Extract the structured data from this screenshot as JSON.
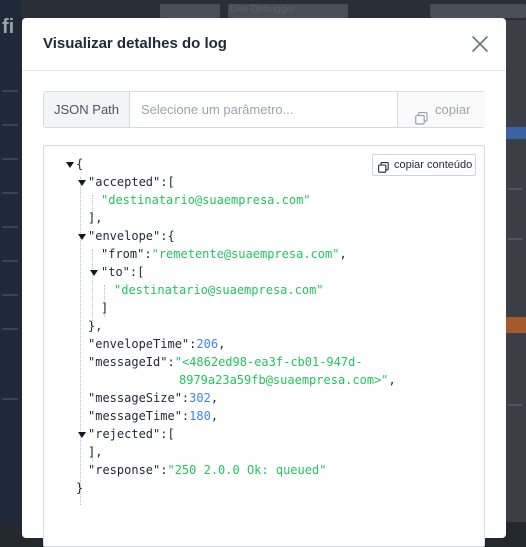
{
  "background": {
    "tab_label": "Live Debugger",
    "logo_text": "fi"
  },
  "modal": {
    "title": "Visualizar detalhes do log",
    "json_path": {
      "addon_label": "JSON Path",
      "placeholder": "Selecione um parâmetro...",
      "value": "",
      "copy_label": "copiar"
    },
    "viewer": {
      "copy_content_label": "copiar conteúdo",
      "lines": {
        "l01": "{",
        "l02_key": "\"accepted\"",
        "l02_rest": ":[",
        "l03": "\"destinatario@suaempresa.com\"",
        "l04": "],",
        "l05_key": "\"envelope\"",
        "l05_rest": ":{",
        "l06_key": "\"from\"",
        "l06_colon": ":",
        "l06_val": "\"remetente@suaempresa.com\"",
        "l06_end": ",",
        "l07_key": "\"to\"",
        "l07_rest": ":[",
        "l08": "\"destinatario@suaempresa.com\"",
        "l09": "]",
        "l10": "},",
        "l11_key": "\"envelopeTime\"",
        "l11_colon": ":",
        "l11_val": "206",
        "l11_end": ",",
        "l12_key": "\"messageId\"",
        "l12_colon": ":",
        "l12_val": "\"<4862ed98-ea3f-cb01-947d-",
        "l13_val": "8979a23a59fb@suaempresa.com>\"",
        "l13_end": ",",
        "l14_key": "\"messageSize\"",
        "l14_colon": ":",
        "l14_val": "302",
        "l14_end": ",",
        "l15_key": "\"messageTime\"",
        "l15_colon": ":",
        "l15_val": "180",
        "l15_end": ",",
        "l16_key": "\"rejected\"",
        "l16_rest": ":[",
        "l17": "],",
        "l18_key": "\"response\"",
        "l18_colon": ":",
        "l18_val": "\"250 2.0.0 Ok: queued\"",
        "l19": "}"
      }
    }
  },
  "colors": {
    "string": "#22c55e",
    "number": "#3b82f6",
    "key": "#1f2937",
    "overlay": "#23272e"
  },
  "icons": [
    "close-icon",
    "copy-icon",
    "caret-down-icon"
  ]
}
